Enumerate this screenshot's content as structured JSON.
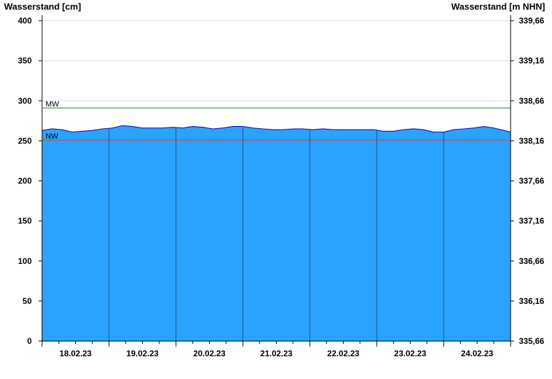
{
  "chart_data": {
    "type": "area",
    "ylabel_left": "Wasserstand [cm]",
    "ylabel_right": "Wasserstand [m NHN]",
    "ylim": [
      0,
      400
    ],
    "yticks_left": [
      0,
      50,
      100,
      150,
      200,
      250,
      300,
      350,
      400
    ],
    "yticks_right": [
      "335,66",
      "336,16",
      "336,66",
      "337,16",
      "337,66",
      "338,16",
      "338,66",
      "339,16",
      "339,66"
    ],
    "x_day_labels": [
      "18.02.23",
      "19.02.23",
      "20.02.23",
      "21.02.23",
      "22.02.23",
      "23.02.23",
      "24.02.23"
    ],
    "x_days": 7,
    "reference_lines": [
      {
        "label": "MW",
        "value": 291,
        "color": "#2e7d32"
      },
      {
        "label": "NW",
        "value": 251,
        "color": "#e53935"
      }
    ],
    "series": [
      {
        "fill": "#29a3ff",
        "line": "#0000cc",
        "x": [
          0,
          0.15,
          0.3,
          0.45,
          0.6,
          0.75,
          0.9,
          1.05,
          1.2,
          1.35,
          1.5,
          1.65,
          1.8,
          1.95,
          2.1,
          2.25,
          2.4,
          2.55,
          2.7,
          2.85,
          3.0,
          3.15,
          3.3,
          3.45,
          3.6,
          3.75,
          3.9,
          4.05,
          4.2,
          4.35,
          4.5,
          4.65,
          4.8,
          4.95,
          5.1,
          5.25,
          5.4,
          5.55,
          5.7,
          5.85,
          6.0,
          6.15,
          6.3,
          6.45,
          6.6,
          6.75,
          6.9,
          7.0
        ],
        "values": [
          263,
          265,
          264,
          261,
          262,
          263,
          265,
          266,
          269,
          268,
          266,
          266,
          266,
          267,
          266,
          268,
          267,
          265,
          266,
          268,
          268,
          266,
          265,
          264,
          264,
          265,
          265,
          264,
          265,
          264,
          264,
          264,
          264,
          264,
          262,
          262,
          264,
          265,
          264,
          261,
          261,
          264,
          265,
          266,
          268,
          266,
          263,
          261
        ]
      }
    ]
  }
}
